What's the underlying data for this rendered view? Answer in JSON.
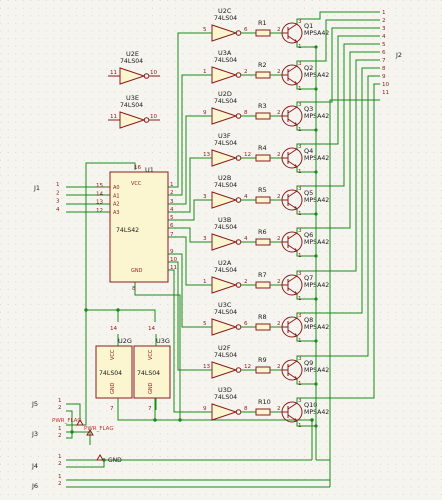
{
  "u1": {
    "ref": "U1",
    "value": "74LS42",
    "left_pins": [
      {
        "num": "15",
        "name": "A0"
      },
      {
        "num": "14",
        "name": "A1"
      },
      {
        "num": "13",
        "name": "A2"
      },
      {
        "num": "12",
        "name": "A3"
      }
    ],
    "right_pins": [
      "1",
      "2",
      "3",
      "4",
      "5",
      "6",
      "7",
      "9",
      "10",
      "11"
    ],
    "vcc": "VCC",
    "vcc_pin": "16",
    "gnd": "GND",
    "gnd_pin": "8"
  },
  "j1": {
    "ref": "J1",
    "pins": [
      "1",
      "2",
      "3",
      "4"
    ]
  },
  "j2": {
    "ref": "J2",
    "pins": [
      "1",
      "2",
      "3",
      "4",
      "5",
      "6",
      "7",
      "8",
      "9",
      "10",
      "11"
    ]
  },
  "inverters": [
    {
      "ref": "U2C",
      "value": "74LS04",
      "in": "5",
      "out": "6"
    },
    {
      "ref": "U3A",
      "value": "74LS04",
      "in": "1",
      "out": "2"
    },
    {
      "ref": "U2D",
      "value": "74LS04",
      "in": "9",
      "out": "8"
    },
    {
      "ref": "U3F",
      "value": "74LS04",
      "in": "13",
      "out": "12"
    },
    {
      "ref": "U2B",
      "value": "74LS04",
      "in": "3",
      "out": "4"
    },
    {
      "ref": "U3B",
      "value": "74LS04",
      "in": "3",
      "out": "4"
    },
    {
      "ref": "U2A",
      "value": "74LS04",
      "in": "1",
      "out": "2"
    },
    {
      "ref": "U3C",
      "value": "74LS04",
      "in": "5",
      "out": "6"
    },
    {
      "ref": "U2F",
      "value": "74LS04",
      "in": "13",
      "out": "12"
    },
    {
      "ref": "U3D",
      "value": "74LS04",
      "in": "9",
      "out": "8"
    }
  ],
  "spare_inverters": [
    {
      "ref": "U2E",
      "value": "74LS04",
      "in": "11",
      "out": "10"
    },
    {
      "ref": "U3E",
      "value": "74LS04",
      "in": "11",
      "out": "10"
    }
  ],
  "resistors": [
    "R1",
    "R2",
    "R3",
    "R4",
    "R5",
    "R6",
    "R7",
    "R8",
    "R9",
    "R10"
  ],
  "transistors": [
    {
      "ref": "Q1",
      "value": "MPSA42"
    },
    {
      "ref": "Q2",
      "value": "MPSA42"
    },
    {
      "ref": "Q3",
      "value": "MPSA42"
    },
    {
      "ref": "Q4",
      "value": "MPSA42"
    },
    {
      "ref": "Q5",
      "value": "MPSA42"
    },
    {
      "ref": "Q6",
      "value": "MPSA42"
    },
    {
      "ref": "Q7",
      "value": "MPSA42"
    },
    {
      "ref": "Q8",
      "value": "MPSA42"
    },
    {
      "ref": "Q9",
      "value": "MPSA42"
    },
    {
      "ref": "Q10",
      "value": "MPSA42"
    }
  ],
  "pin_base": "2",
  "pin_emitter": "1",
  "pin_collector": "3",
  "power_units": [
    {
      "ref": "U2G",
      "value": "74LS04",
      "vcc": "VCC",
      "gnd": "GND",
      "vcc_pin": "14",
      "gnd_pin": "7"
    },
    {
      "ref": "U3G",
      "value": "74LS04",
      "vcc": "VCC",
      "gnd": "GND",
      "vcc_pin": "14",
      "gnd_pin": "7"
    }
  ],
  "connectors": {
    "j5": {
      "ref": "J5",
      "pins": [
        "1",
        "2"
      ]
    },
    "j3": {
      "ref": "J3",
      "pins": [
        "1",
        "2"
      ]
    },
    "j4": {
      "ref": "J4",
      "pins": [
        "1",
        "2"
      ]
    },
    "j6": {
      "ref": "J6",
      "pins": [
        "1",
        "2"
      ]
    }
  },
  "pwr_flags": [
    "PWR_FLAG",
    "PWR_FLAG"
  ],
  "gnd_net": "GND",
  "colors": {
    "wire": "#1a8a1a",
    "component": "#8b1c1c",
    "body": "#fbf6cf",
    "background": "#f5f4ef"
  }
}
